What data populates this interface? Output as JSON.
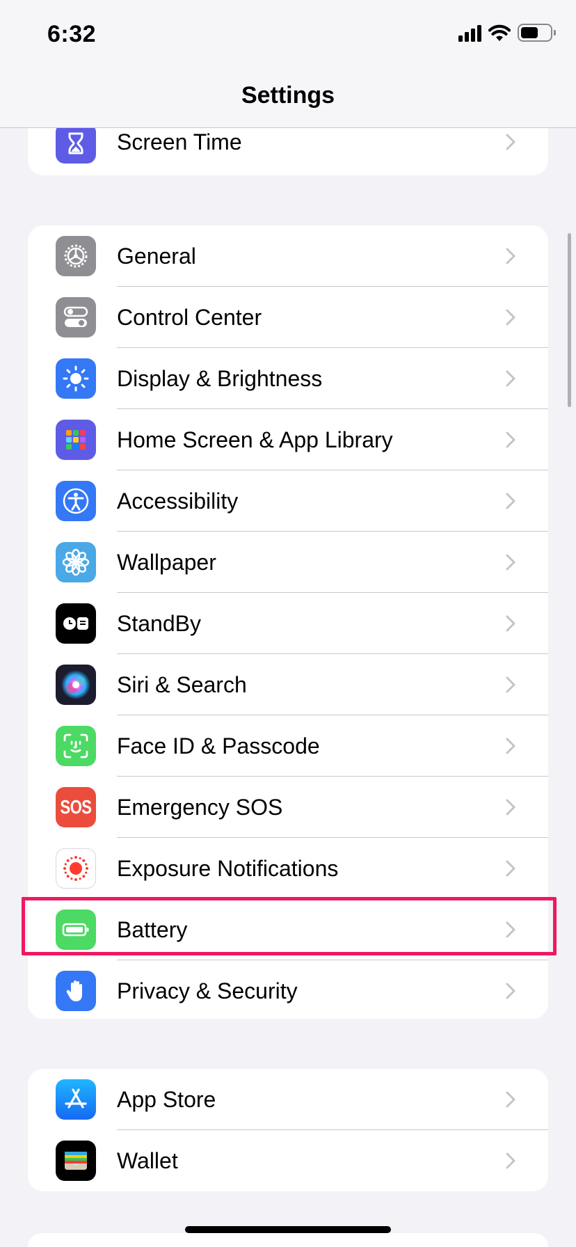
{
  "status": {
    "time": "6:32",
    "battery_level": 0.6
  },
  "nav": {
    "title": "Settings"
  },
  "groups": [
    {
      "items": [
        {
          "label": "Screen Time",
          "icon": "hourglass-icon",
          "color": "#5e5ce6"
        }
      ]
    },
    {
      "items": [
        {
          "label": "General",
          "icon": "gear-icon",
          "color": "#8e8e93"
        },
        {
          "label": "Control Center",
          "icon": "toggles-icon",
          "color": "#8e8e93"
        },
        {
          "label": "Display & Brightness",
          "icon": "sun-icon",
          "color": "#3478f6"
        },
        {
          "label": "Home Screen & App Library",
          "icon": "app-grid-icon",
          "color": "#5e5ce6"
        },
        {
          "label": "Accessibility",
          "icon": "accessibility-icon",
          "color": "#3478f6"
        },
        {
          "label": "Wallpaper",
          "icon": "flower-icon",
          "color": "#4aa8e6"
        },
        {
          "label": "StandBy",
          "icon": "standby-icon",
          "color": "#000000"
        },
        {
          "label": "Siri & Search",
          "icon": "siri-icon",
          "color": "#1c1c2e"
        },
        {
          "label": "Face ID & Passcode",
          "icon": "face-id-icon",
          "color": "#4cd964"
        },
        {
          "label": "Emergency SOS",
          "icon": "sos-icon",
          "color": "#eb4d3d"
        },
        {
          "label": "Exposure Notifications",
          "icon": "exposure-icon",
          "color": "#ffffff"
        },
        {
          "label": "Battery",
          "icon": "battery-icon",
          "color": "#4cd964"
        },
        {
          "label": "Privacy & Security",
          "icon": "hand-icon",
          "color": "#3478f6"
        }
      ]
    },
    {
      "items": [
        {
          "label": "App Store",
          "icon": "app-store-icon",
          "color": "#1a8cf5"
        },
        {
          "label": "Wallet",
          "icon": "wallet-icon",
          "color": "#000000"
        }
      ]
    }
  ],
  "sos_text": "SOS",
  "highlighted_item": "Battery"
}
